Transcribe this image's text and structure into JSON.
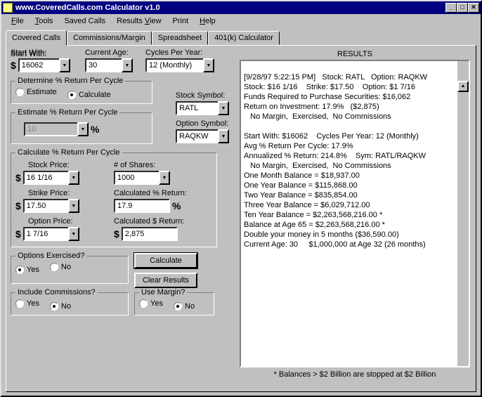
{
  "window": {
    "title": "www.CoveredCalls.com Calculator v1.0"
  },
  "menu": {
    "file": "File",
    "tools": "Tools",
    "saved": "Saved Calls",
    "results": "Results View",
    "print": "Print",
    "help": "Help"
  },
  "tabs": {
    "t1": "Covered Calls",
    "t2": "Commissions/Margin",
    "t3": "Spreadsheet",
    "t4": "401(k) Calculator"
  },
  "labels": {
    "start_with": "Start With:",
    "current_age": "Current Age:",
    "cycles": "Cycles Per Year:",
    "determine": "Determine % Return Per Cycle",
    "estimate_opt": "Estimate",
    "calculate_opt": "Calculate",
    "estimate_box": "Estimate % Return Per Cycle",
    "stock_symbol": "Stock Symbol:",
    "option_symbol": "Option Symbol:",
    "calc_box": "Calculate % Return Per Cycle",
    "stock_price": "Stock Price:",
    "shares": "# of Shares:",
    "strike": "Strike Price:",
    "calc_pct": "Calculated % Return:",
    "option_price": "Option Price:",
    "calc_dollar": "Calculated $ Return:",
    "exercised": "Options Exercised?",
    "include_comm": "Include Commissions?",
    "use_margin": "Use Margin?",
    "yes": "Yes",
    "no": "No",
    "calculate_btn": "Calculate",
    "clear_btn": "Clear Results",
    "results": "RESULTS"
  },
  "values": {
    "start_with": "16062",
    "current_age": "30",
    "cycles": "12 (Monthly)",
    "est_pct": "10",
    "stock_symbol": "RATL",
    "option_symbol": "RAQKW",
    "stock_price": "16 1/16",
    "shares": "1000",
    "strike": "17.50",
    "calc_pct": "17.9",
    "option_price": "1 7/16",
    "calc_dollar": "2,875"
  },
  "results": {
    "l1": "[9/28/97 5:22:15 PM]   Stock: RATL   Option: RAQKW",
    "l2": "Stock: $16 1/16    Strike: $17.50    Option: $1 7/16",
    "l3": "Funds Required to Purchase Securities: $16,062",
    "l4": "Return on Investment: 17.9%   ($2,875)",
    "l5": "   No Margin,  Exercised,  No Commissions",
    "l6": "",
    "l7": "Start With: $16062    Cycles Per Year: 12 (Monthly)",
    "l8": "Avg % Return Per Cycle: 17.9%",
    "l9": "Annualized % Return: 214.8%    Sym: RATL/RAQKW",
    "l10": "   No Margin,  Exercised,  No Commissions",
    "l11": "One Month Balance = $18,937.00",
    "l12": "One Year Balance = $115,868.00",
    "l13": "Two Year Balance = $835,854.00",
    "l14": "Three Year Balance = $6,029,712.00",
    "l15": "Ten Year Balance = $2,263,568,216.00 *",
    "l16": "Balance at Age 65 = $2,263,568,216.00 *",
    "l17": "Double your money in 5 months ($36,590.00)",
    "l18": "Current Age: 30     $1,000,000 at Age 32 (26 months)"
  },
  "footnote": "* Balances > $2 Billion are stopped at $2 Billion"
}
